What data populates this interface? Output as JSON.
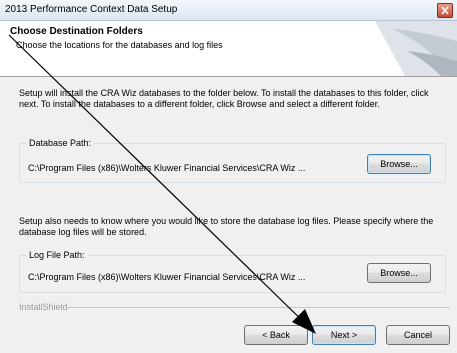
{
  "window": {
    "title": "2013 Performance Context Data Setup",
    "close_icon": "close-icon"
  },
  "header": {
    "title": "Choose Destination Folders",
    "subtitle": "Choose the locations for the databases and log files"
  },
  "intro_text": "Setup will install the CRA Wiz databases to the folder below.  To install the databases to this folder, click next.  To install the databases to a different folder, click Browse and select a different folder.",
  "database": {
    "label": "Database Path:",
    "path": "C:\\Program Files (x86)\\Wolters Kluwer Financial Services\\CRA Wiz ...",
    "browse_label": "Browse..."
  },
  "log_intro": "Setup also needs to know where you would like to store the database log files.  Please specify where the database log files will be stored.",
  "log": {
    "label": "Log File Path:",
    "path": "C:\\Program Files (x86)\\Wolters Kluwer Financial Services\\CRA Wiz ...",
    "browse_label": "Browse..."
  },
  "brand": "InstallShield",
  "buttons": {
    "back": "< Back",
    "next": "Next >",
    "cancel": "Cancel"
  },
  "colors": {
    "accent": "#3c7fb1",
    "close": "#c14d35",
    "annotation_arrow": "#000000"
  }
}
